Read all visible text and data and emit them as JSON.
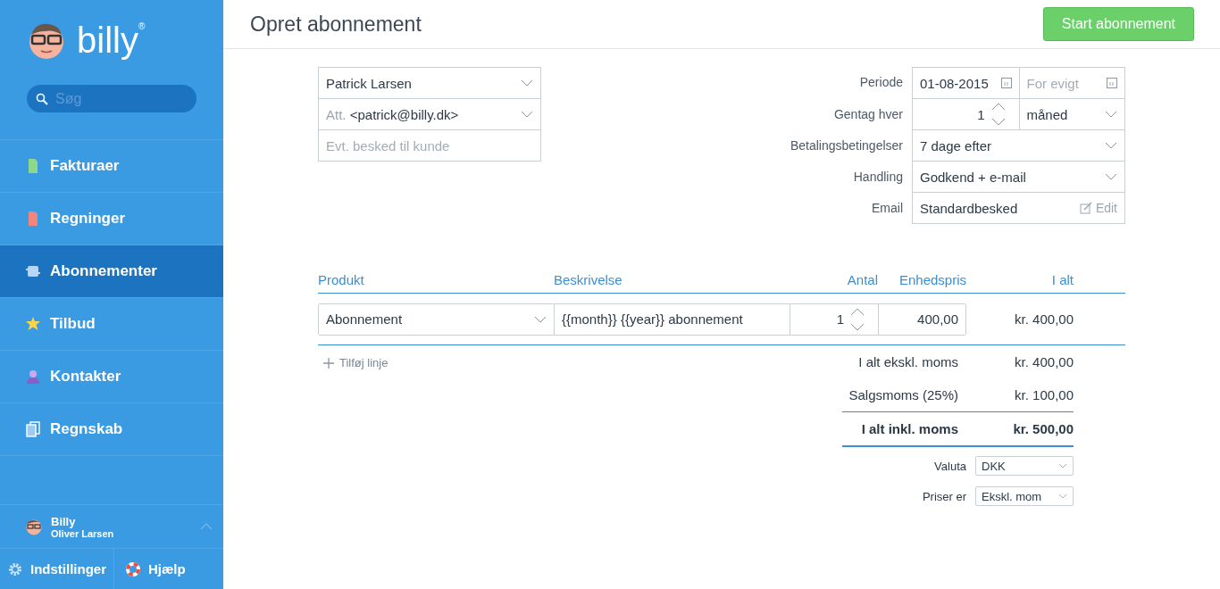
{
  "sidebar": {
    "logo": {
      "text": "billy",
      "mark": "®"
    },
    "search": {
      "placeholder": "Søg"
    },
    "items": [
      {
        "label": "Fakturaer",
        "kind": "invoice",
        "selected": false
      },
      {
        "label": "Regninger",
        "kind": "bill",
        "selected": false
      },
      {
        "label": "Abonnementer",
        "kind": "subscription",
        "selected": true
      },
      {
        "label": "Tilbud",
        "kind": "quote",
        "selected": false
      },
      {
        "label": "Kontakter",
        "kind": "contact",
        "selected": false
      },
      {
        "label": "Regnskab",
        "kind": "accounting",
        "selected": false
      }
    ],
    "user": {
      "organization": "Billy",
      "name": "Oliver Larsen"
    },
    "footer": [
      {
        "label": "Indstillinger",
        "kind": "settings"
      },
      {
        "label": "Hjælp",
        "kind": "help"
      }
    ]
  },
  "header": {
    "title": "Opret abonnement",
    "button": "Start abonnement"
  },
  "customer": {
    "contact": "Patrick Larsen",
    "att_label": "Att.",
    "att_value": "<patrick@billy.dk>",
    "message": {
      "placeholder": "Evt. besked til kunde"
    }
  },
  "settings": {
    "period": {
      "label": "Periode",
      "start": "01-08-2015",
      "end": {
        "placeholder": "For evigt"
      }
    },
    "repeat": {
      "label": "Gentag hver",
      "count": "1",
      "unit": "måned"
    },
    "terms": {
      "label": "Betalingsbetingelser",
      "value": "7 dage efter"
    },
    "action": {
      "label": "Handling",
      "value": "Godkend + e-mail"
    },
    "email": {
      "label": "Email",
      "value": "Standardbesked",
      "edit": "Edit"
    }
  },
  "lines": {
    "columns": [
      "Produkt",
      "Beskrivelse",
      "Antal",
      "Enhedspris",
      "I alt"
    ],
    "rows": [
      {
        "product": "Abonnement",
        "description": "{{month}} {{year}} abonnement",
        "quantity": "1",
        "unit_price": "400,00",
        "total": "kr. 400,00"
      }
    ],
    "add": "Tilføj linje"
  },
  "totals": [
    {
      "label": "I alt ekskl. moms",
      "value": "kr. 400,00",
      "kind": "subtotal"
    },
    {
      "label": "Salgsmoms (25%)",
      "value": "kr. 100,00",
      "kind": "tax"
    },
    {
      "label": "I alt inkl. moms",
      "value": "kr. 500,00",
      "kind": "total"
    }
  ],
  "options": [
    {
      "label": "Valuta",
      "value": "DKK"
    },
    {
      "label": "Priser er",
      "value": "Ekskl. mom"
    }
  ]
}
